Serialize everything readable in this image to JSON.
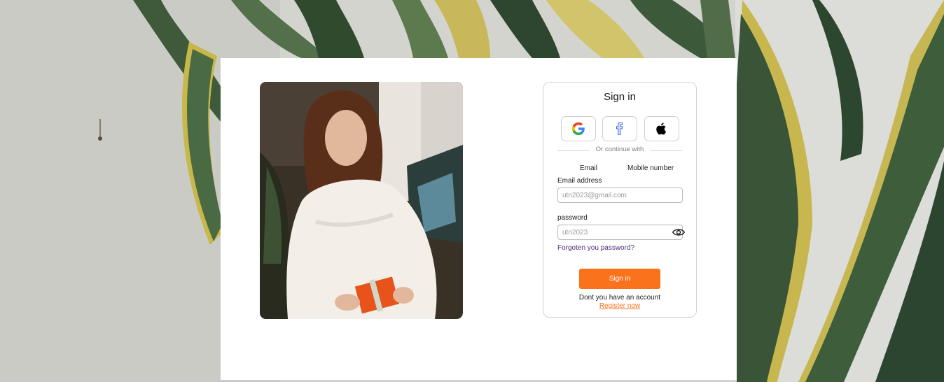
{
  "signin": {
    "title": "Sign in",
    "social": [
      {
        "name": "google-icon"
      },
      {
        "name": "facebook-icon"
      },
      {
        "name": "apple-icon"
      }
    ],
    "divider_text": "Or continue with",
    "tabs": [
      "Email",
      "Mobile number"
    ],
    "email_label": "Email address",
    "email_placeholder": "utn2023@gmail.com",
    "password_label": "password",
    "password_placeholder": "utn2023",
    "forgot": "Forgoten you password?",
    "submit": "Sign in",
    "no_account": "Dont you have an account",
    "register": "Register now"
  },
  "colors": {
    "accent": "#fb721d",
    "link": "#4b2f7a"
  }
}
